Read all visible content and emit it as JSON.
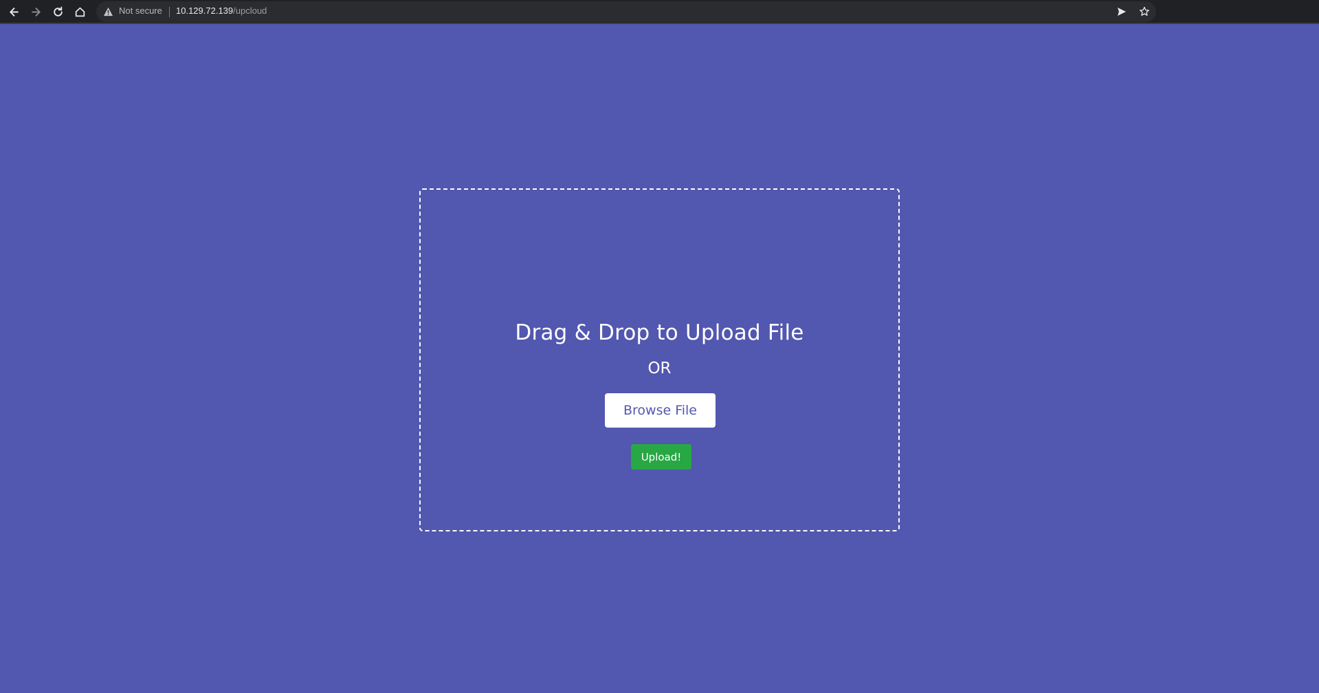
{
  "browser": {
    "security_label": "Not secure",
    "url_host": "10.129.72.139",
    "url_path": "/upcloud",
    "icons": [
      "back-icon",
      "forward-icon",
      "reload-icon",
      "home-icon",
      "warning-icon",
      "send-icon",
      "star-icon"
    ]
  },
  "page": {
    "background_color": "#5257af",
    "heading": "Drag & Drop to Upload File",
    "or_text": "OR",
    "browse_button_label": "Browse File",
    "upload_button_label": "Upload!",
    "upload_button_color": "#28a745"
  }
}
